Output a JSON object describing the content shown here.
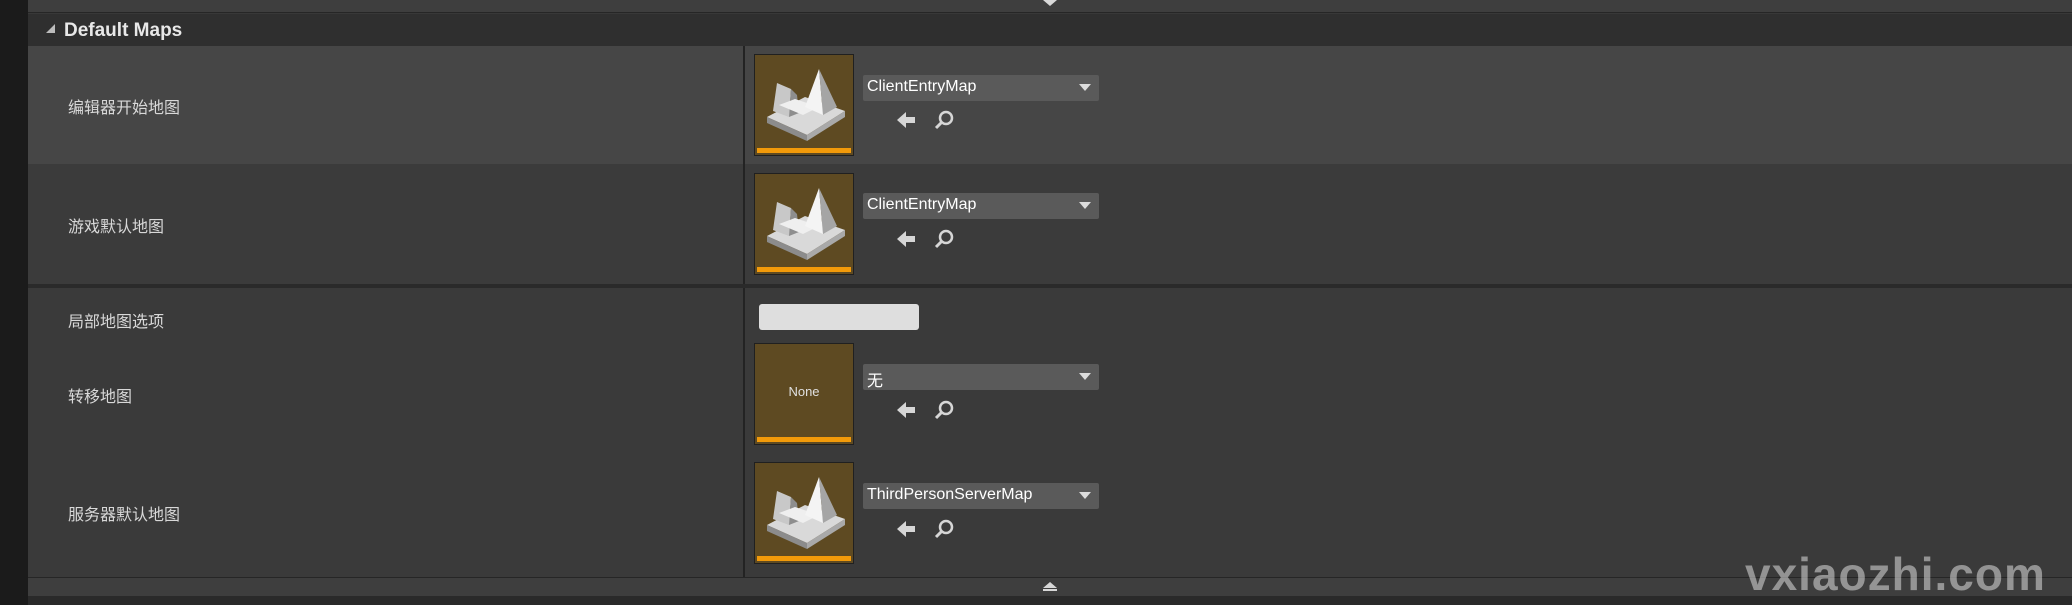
{
  "section": {
    "title": "Default Maps"
  },
  "rows": [
    {
      "label": "编辑器开始地图",
      "map_value": "ClientEntryMap"
    },
    {
      "label": "游戏默认地图",
      "map_value": "ClientEntryMap"
    },
    {
      "label": "局部地图选项",
      "text_value": ""
    },
    {
      "label": "转移地图",
      "map_value": "无",
      "thumbnail_text": "None"
    },
    {
      "label": "服务器默认地图",
      "map_value": "ThirdPersonServerMap"
    }
  ],
  "icons": {
    "use_selected": "arrow-left-icon",
    "browse": "magnifier-icon",
    "collapse_up": "chevron-up-icon",
    "expand_down": "chevron-down-icon",
    "section_toggle": "triangle-expanded-icon",
    "map_thumbnail": "level-map-icon"
  },
  "colors": {
    "thumbnail_bg": "#5e4a22",
    "asset_accent": "#f29a0a",
    "panel_bg": "#383838"
  },
  "watermark": "vxiaozhi.com"
}
